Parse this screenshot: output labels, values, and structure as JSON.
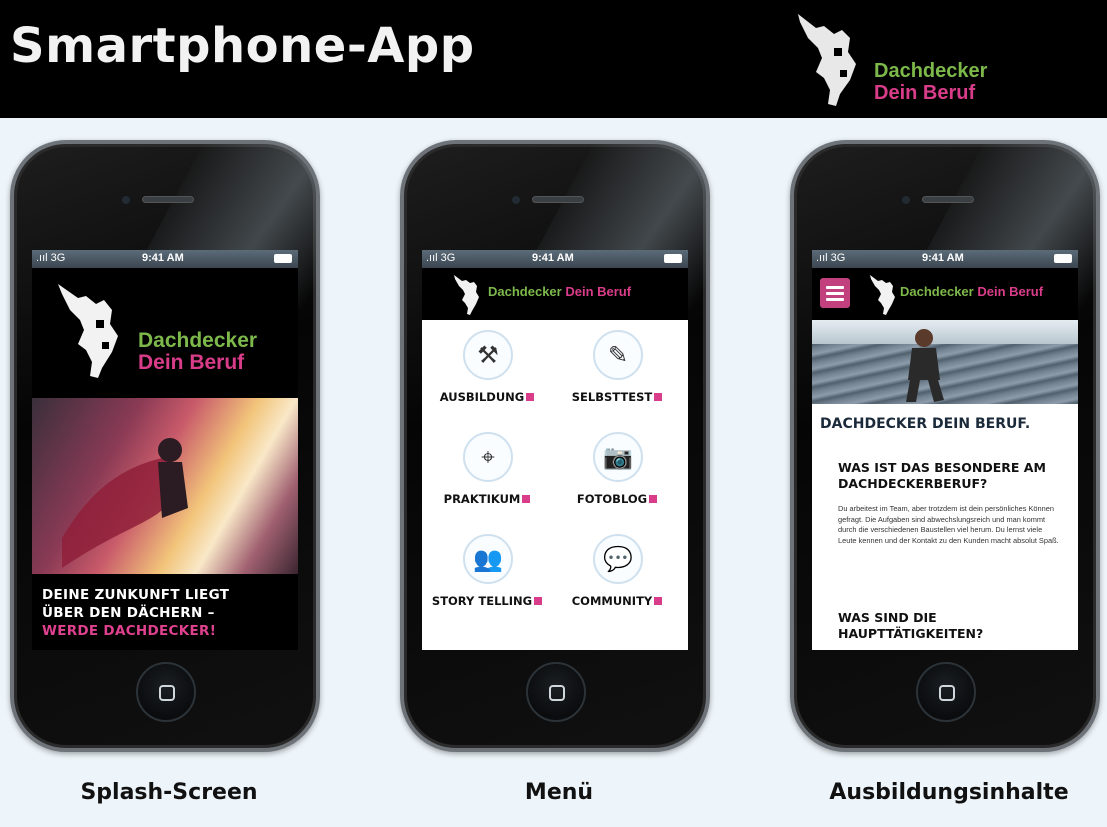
{
  "header": {
    "title": "Smartphone-App",
    "brand_line1": "Dachdecker",
    "brand_line2": "Dein Beruf"
  },
  "colors": {
    "brand_green": "#7db84a",
    "brand_pink": "#d93d8a",
    "header_bg": "#000000",
    "page_bg": "#eef5fa"
  },
  "status_bar": {
    "signal": ".ııl 3G",
    "time": "9:41 AM"
  },
  "splash": {
    "brand_line1": "Dachdecker",
    "brand_line2": "Dein Beruf",
    "tagline_line1": "DEINE ZUNKUNFT LIEGT",
    "tagline_line2": "ÜBER DEN DÄCHERN –",
    "tagline_line3": "WERDE DACHDECKER!"
  },
  "appbar": {
    "brand_green": "Dachdecker",
    "brand_pink": "Dein Beruf"
  },
  "menu": {
    "items": [
      {
        "label": "AUSBILDUNG",
        "icon": "tools-icon",
        "glyph": "⚒"
      },
      {
        "label": "SELBSTTEST",
        "icon": "edit-icon",
        "glyph": "✎"
      },
      {
        "label": "PRAKTIKUM",
        "icon": "map-pin-icon",
        "glyph": "⌖"
      },
      {
        "label": "FOTOBLOG",
        "icon": "camera-icon",
        "glyph": "📷"
      },
      {
        "label": "STORY TELLING",
        "icon": "people-icon",
        "glyph": "👥"
      },
      {
        "label": "COMMUNITY",
        "icon": "chat-icon",
        "glyph": "💬"
      }
    ]
  },
  "content": {
    "title": "DACHDECKER DEIN BERUF.",
    "heading1": "WAS IST DAS BESONDERE AM DACHDECKERBERUF?",
    "body": "Du arbeitest im Team, aber trotzdem ist dein persönliches Können gefragt. Die Aufgaben sind abwechslungsreich und man kommt durch die verschiedenen Baustellen viel herum. Du lernst viele Leute kennen und der Kontakt zu den Kunden macht absolut Spaß.",
    "heading2": "WAS SIND DIE HAUPTTÄTIGKEITEN?"
  },
  "captions": {
    "phone1": "Splash-Screen",
    "phone2": "Menü",
    "phone3": "Ausbildungsinhalte"
  }
}
